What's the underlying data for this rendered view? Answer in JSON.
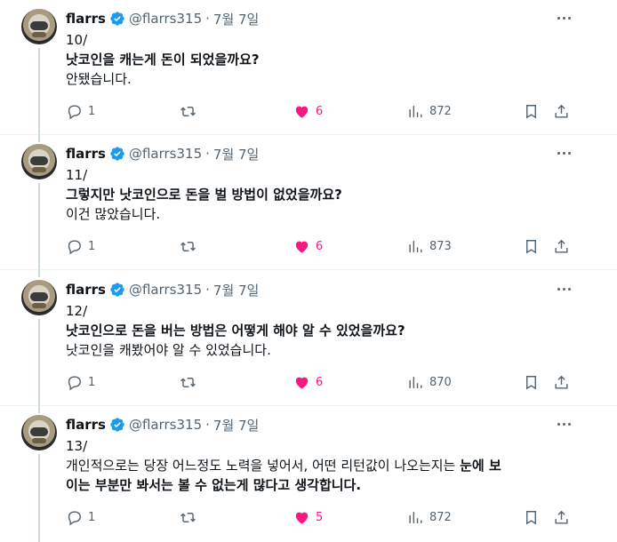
{
  "colors": {
    "text": "#0f1419",
    "secondary": "#536471",
    "like": "#f91880",
    "verified": "#1d9bf0",
    "divider": "#eff3f4"
  },
  "tweets": [
    {
      "name": "flarrs",
      "handle": "@flarrs315",
      "separator": "·",
      "date": "7월 7일",
      "lines": [
        "10/",
        "낫코인을 캐는게 돈이 되었을까요?",
        "안됐습니다."
      ],
      "reply_count": "1",
      "like_count": "6",
      "view_count": "872"
    },
    {
      "name": "flarrs",
      "handle": "@flarrs315",
      "separator": "·",
      "date": "7월 7일",
      "lines": [
        "11/",
        "그렇지만 낫코인으로 돈을 벌 방법이 없었을까요?",
        "이건 많았습니다."
      ],
      "reply_count": "1",
      "like_count": "6",
      "view_count": "873"
    },
    {
      "name": "flarrs",
      "handle": "@flarrs315",
      "separator": "·",
      "date": "7월 7일",
      "lines": [
        "12/",
        "낫코인으로 돈을 버는 방법은 어떻게 해야 알 수 있었을까요?",
        "낫코인을 캐봤어야 알 수 있었습니다."
      ],
      "reply_count": "1",
      "like_count": "6",
      "view_count": "870"
    },
    {
      "name": "flarrs",
      "handle": "@flarrs315",
      "separator": "·",
      "date": "7월 7일",
      "lines": [
        "13/",
        "개인적으로는 당장 어느정도 노력을 넣어서, 어떤 리턴값이 나오는지는 ",
        "눈에 보",
        "이는 부분만 봐서는 볼 수 없는게 많다고 생각합니다."
      ],
      "reply_count": "1",
      "like_count": "5",
      "view_count": "872"
    }
  ]
}
